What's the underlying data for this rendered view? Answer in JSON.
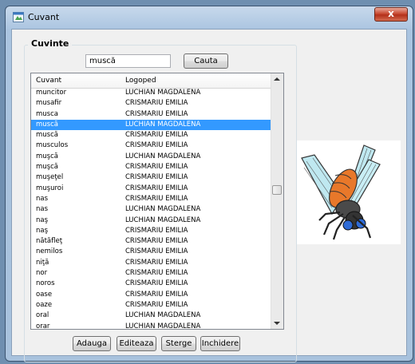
{
  "window": {
    "title": "Cuvant",
    "close_label": "x"
  },
  "group": {
    "legend": "Cuvinte"
  },
  "search": {
    "value": "muscă",
    "button_label": "Cauta"
  },
  "table": {
    "columns": [
      "Cuvant",
      "Logoped"
    ],
    "rows": [
      [
        "muncitor",
        "LUCHIAN MAGDALENA"
      ],
      [
        "musafir",
        "CRISMARIU EMILIA"
      ],
      [
        "musca",
        "CRISMARIU EMILIA"
      ],
      [
        "muscă",
        "LUCHIAN MAGDALENA"
      ],
      [
        "muscă",
        "CRISMARIU EMILIA"
      ],
      [
        "musculos",
        "CRISMARIU EMILIA"
      ],
      [
        "muşcă",
        "LUCHIAN MAGDALENA"
      ],
      [
        "muşcă",
        "CRISMARIU EMILIA"
      ],
      [
        "muşeţel",
        "CRISMARIU EMILIA"
      ],
      [
        "muşuroi",
        "CRISMARIU EMILIA"
      ],
      [
        "nas",
        "CRISMARIU EMILIA"
      ],
      [
        "nas",
        "LUCHIAN MAGDALENA"
      ],
      [
        "naş",
        "LUCHIAN MAGDALENA"
      ],
      [
        "naş",
        "CRISMARIU EMILIA"
      ],
      [
        "nătăfleţ",
        "CRISMARIU EMILIA"
      ],
      [
        "nemilos",
        "CRISMARIU EMILIA"
      ],
      [
        "niţă",
        "CRISMARIU EMILIA"
      ],
      [
        "nor",
        "CRISMARIU EMILIA"
      ],
      [
        "noros",
        "CRISMARIU EMILIA"
      ],
      [
        "oase",
        "CRISMARIU EMILIA"
      ],
      [
        "oaze",
        "CRISMARIU EMILIA"
      ],
      [
        "oral",
        "LUCHIAN MAGDALENA"
      ],
      [
        "orar",
        "LUCHIAN MAGDALENA"
      ]
    ],
    "selected_index": 3
  },
  "buttons": {
    "add": "Adauga",
    "edit": "Editeaza",
    "delete": "Sterge",
    "close": "Inchidere"
  },
  "colors": {
    "selection": "#3399ff",
    "close_button": "#c84a32"
  },
  "icons": {
    "app": "app-window-icon",
    "picture": "fly-illustration"
  }
}
